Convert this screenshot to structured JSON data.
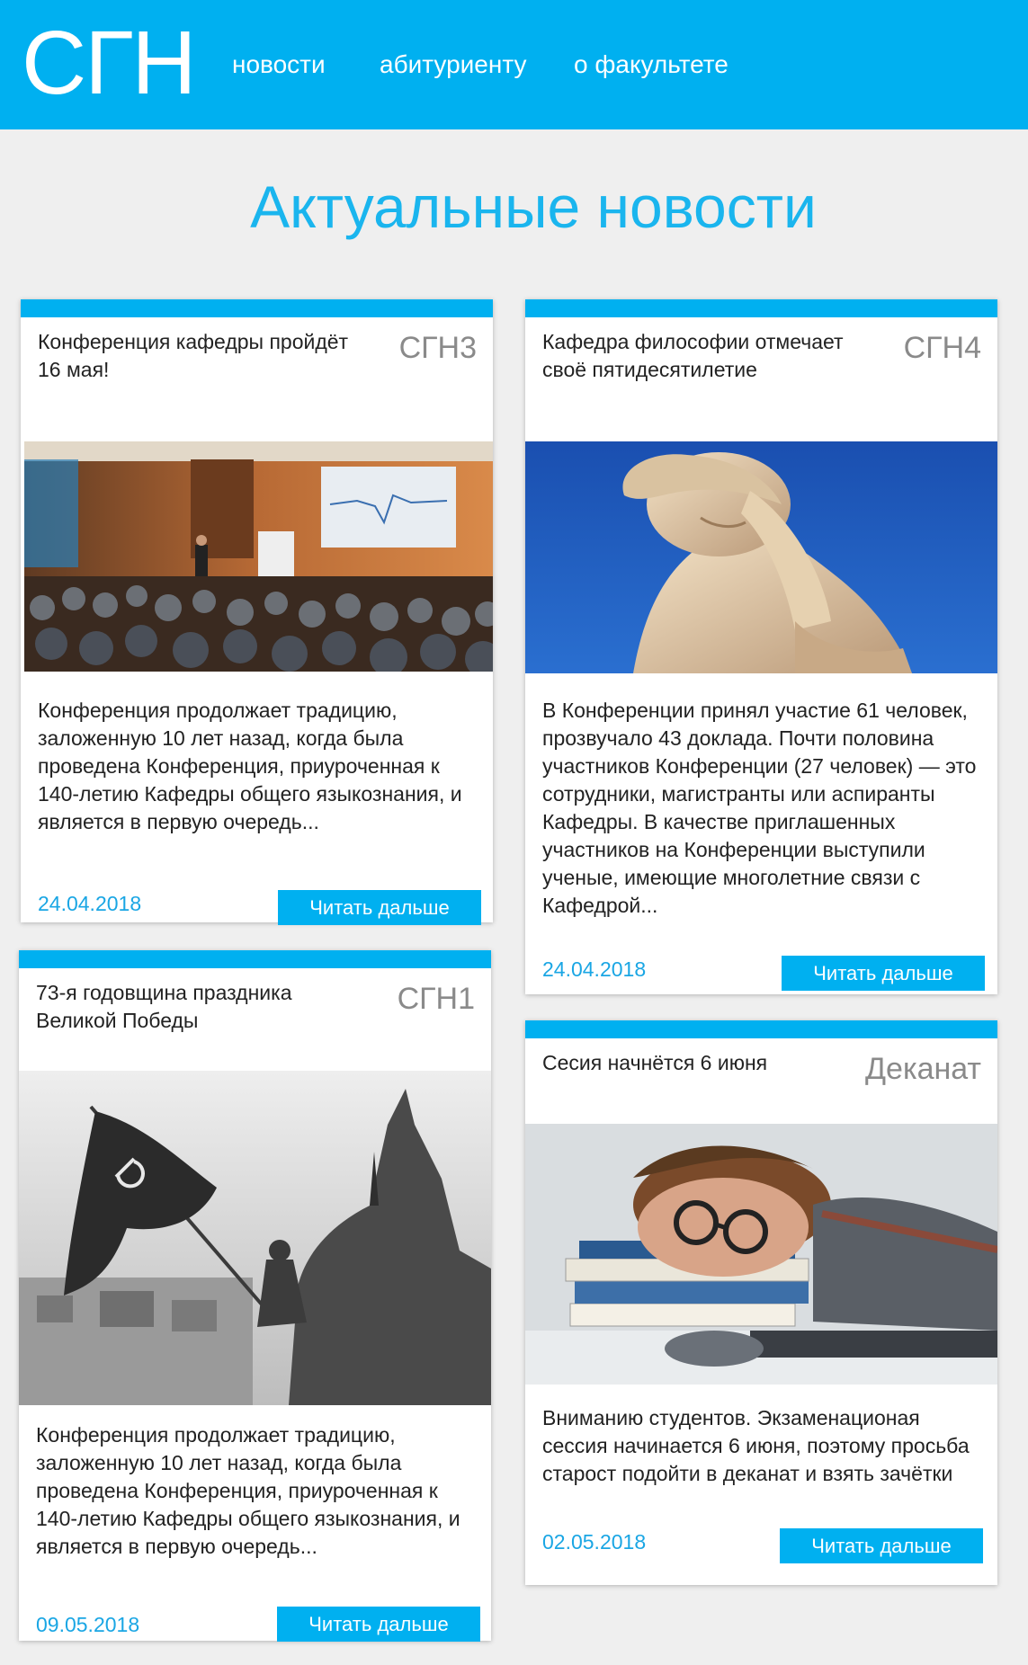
{
  "header": {
    "logo": "СГН",
    "nav": [
      "новости",
      "абитуриенту",
      "о факультете"
    ]
  },
  "page_title": "Актуальные новости",
  "cards": [
    {
      "title": "Конференция кафедры пройдёт 16 мая!",
      "source": "СГН3",
      "image": "conference-hall-photo",
      "text": "Конференция продолжает традицию, заложенную 10 лет назад, когда была проведена Конференция, приуроченная к 140-летию Кафедры общего языкознания, и является в первую очередь...",
      "date": "24.04.2018",
      "button": "Читать дальше"
    },
    {
      "title": "Кафедра философии отмечает своё пятидесятилетие",
      "source": "СГН4",
      "image": "statue-facepalm-photo",
      "text": "В Конференции принял участие 61 человек, прозвучало 43 доклада. Почти половина участников Конференции (27 человек) — это сотрудники, магистранты или аспиранты Кафедры. В качестве приглашенных участников на Конференции выступили ученые, имеющие многолетние связи с Кафедрой...",
      "date": "24.04.2018",
      "button": "Читать дальше"
    },
    {
      "title": "73-я годовщина праздника Великой Победы",
      "source": "СГН1",
      "image": "victory-flag-photo",
      "text": "Конференция продолжает традицию, заложенную 10 лет назад, когда была проведена Конференция, приуроченная к 140-летию Кафедры общего языкознания, и является в первую очередь...",
      "date": "09.05.2018",
      "button": "Читать дальше"
    },
    {
      "title": "Сесия начнётся 6 июня",
      "source": "Деканат",
      "image": "sleeping-student-photo",
      "text": "Вниманию студентов. Экзаменационая сессия начинается 6 июня, поэтому просьба старост подойти в деканат и взять зачётки",
      "date": "02.05.2018",
      "button": "Читать дальше"
    }
  ]
}
